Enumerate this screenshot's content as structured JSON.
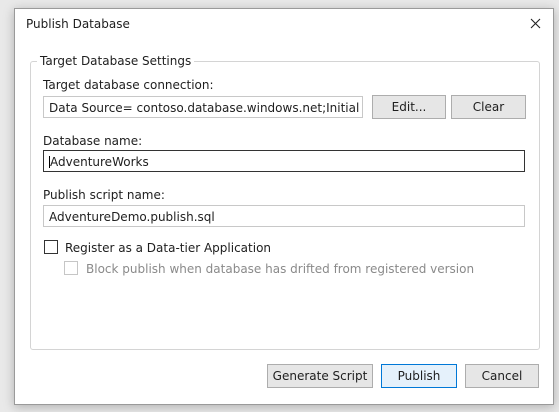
{
  "dialog": {
    "title": "Publish Database"
  },
  "group": {
    "legend": "Target Database Settings"
  },
  "connection": {
    "label": "Target database connection:",
    "value": "Data Source= contoso.database.windows.net;Initial Catalog",
    "edit_label": "Edit...",
    "clear_label": "Clear"
  },
  "database": {
    "label": "Database name:",
    "value": "AdventureWorks"
  },
  "script": {
    "label": "Publish script name:",
    "value": "AdventureDemo.publish.sql"
  },
  "options": {
    "register_label": "Register as a Data-tier Application",
    "register_checked": false,
    "block_label": "Block publish when database has drifted from registered version",
    "block_checked": false,
    "block_enabled": false
  },
  "buttons": {
    "generate_label": "Generate Script",
    "publish_label": "Publish",
    "cancel_label": "Cancel"
  },
  "icons": {
    "close": "close-icon"
  }
}
